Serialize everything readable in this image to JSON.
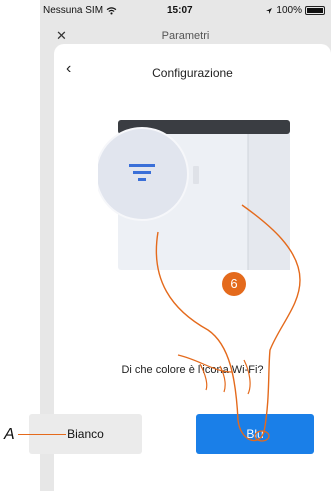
{
  "status": {
    "carrier": "Nessuna SIM",
    "time": "15:07",
    "battery": "100%"
  },
  "behind": {
    "title": "Parametri"
  },
  "header": {
    "title": "Configurazione"
  },
  "question": "Di che colore è l'icona Wi-Fi?",
  "buttons": {
    "white": "Bianco",
    "blue": "Blu"
  },
  "annotations": {
    "label_a": "A",
    "step": "6"
  },
  "icons": {
    "back": "chevron-left-icon",
    "wifi": "wifi-icon",
    "location": "location-arrow-icon"
  },
  "colors": {
    "accent_blue": "#1a7fe8",
    "annotation_orange": "#e46a1c",
    "wifi_icon_blue": "#3a6fd8"
  }
}
